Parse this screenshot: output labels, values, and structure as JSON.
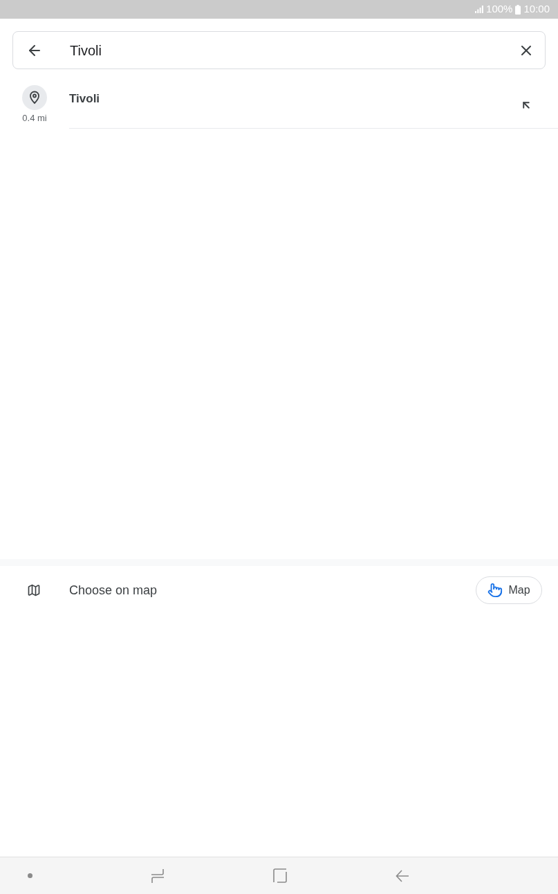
{
  "status_bar": {
    "battery": "100%",
    "time": "10:00"
  },
  "search": {
    "value": "Tivoli"
  },
  "suggestions": [
    {
      "title": "Tivoli",
      "distance": "0.4 mi"
    }
  ],
  "choose_on_map": {
    "label": "Choose on map",
    "button": "Map"
  }
}
